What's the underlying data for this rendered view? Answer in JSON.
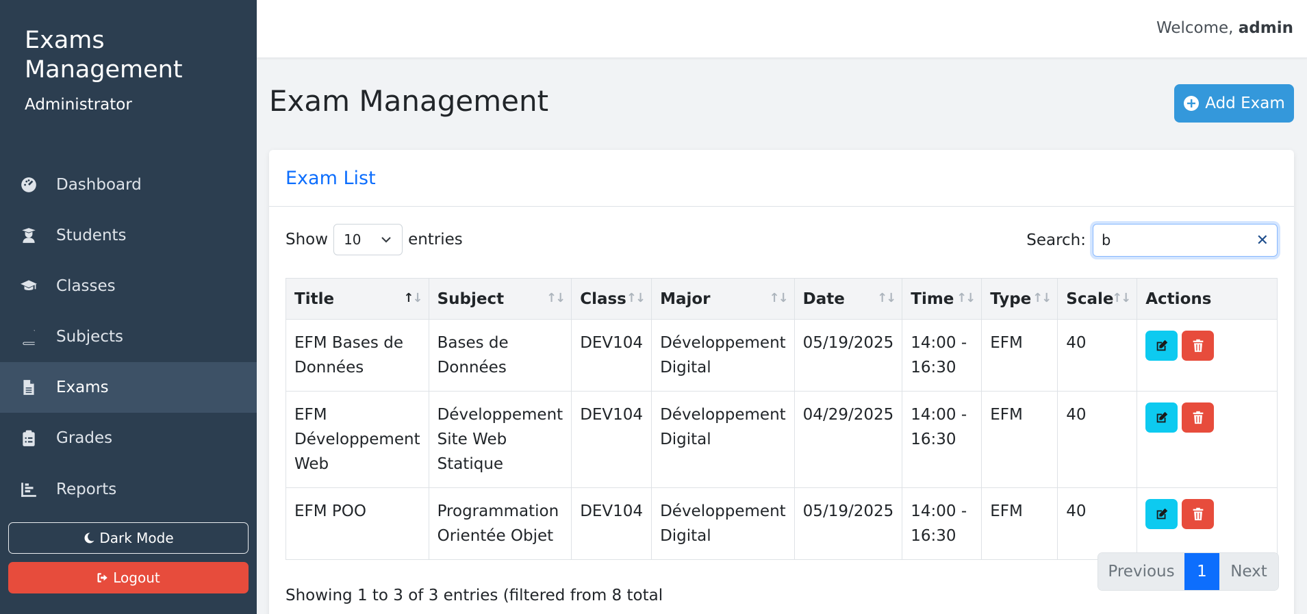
{
  "sidebar": {
    "brand": "Exams Management",
    "role": "Administrator",
    "items": [
      {
        "label": "Dashboard",
        "icon": "gauge-icon"
      },
      {
        "label": "Students",
        "icon": "student-icon"
      },
      {
        "label": "Classes",
        "icon": "graduation-cap-icon"
      },
      {
        "label": "Subjects",
        "icon": "book-icon"
      },
      {
        "label": "Exams",
        "icon": "file-icon"
      },
      {
        "label": "Grades",
        "icon": "clipboard-icon"
      },
      {
        "label": "Reports",
        "icon": "chart-icon"
      }
    ],
    "active": "Exams",
    "dark_mode_label": "Dark Mode",
    "logout_label": "Logout"
  },
  "topbar": {
    "welcome_prefix": "Welcome,",
    "username": "admin"
  },
  "page": {
    "title": "Exam Management",
    "add_button": "Add Exam"
  },
  "card": {
    "title": "Exam List",
    "show_label": "Show",
    "page_size": "10",
    "entries_label": "entries",
    "search_label": "Search:",
    "search_value": "b"
  },
  "table": {
    "columns": [
      "Title",
      "Subject",
      "Class",
      "Major",
      "Date",
      "Time",
      "Type",
      "Scale",
      "Actions"
    ],
    "rows": [
      {
        "title": "EFM Bases de Données",
        "subject": "Bases de Données",
        "class": "DEV104",
        "major": "Développement Digital",
        "date": "05/19/2025",
        "time": "14:00 - 16:30",
        "type": "EFM",
        "scale": "40"
      },
      {
        "title": "EFM Développement Web",
        "subject": "Développement Site Web Statique",
        "class": "DEV104",
        "major": "Développement Digital",
        "date": "04/29/2025",
        "time": "14:00 - 16:30",
        "type": "EFM",
        "scale": "40"
      },
      {
        "title": "EFM POO",
        "subject": "Programmation Orientée Objet",
        "class": "DEV104",
        "major": "Développement Digital",
        "date": "05/19/2025",
        "time": "14:00 - 16:30",
        "type": "EFM",
        "scale": "40"
      }
    ]
  },
  "footer": {
    "info": "Showing 1 to 3 of 3 entries (filtered from 8 total",
    "prev_label": "Previous",
    "current_page": "1",
    "next_label": "Next"
  },
  "colors": {
    "sidebar": "#2c3e50",
    "accent": "#3498db",
    "danger": "#e74c3c",
    "info": "#0dcaf0",
    "primary": "#0d6efd"
  }
}
